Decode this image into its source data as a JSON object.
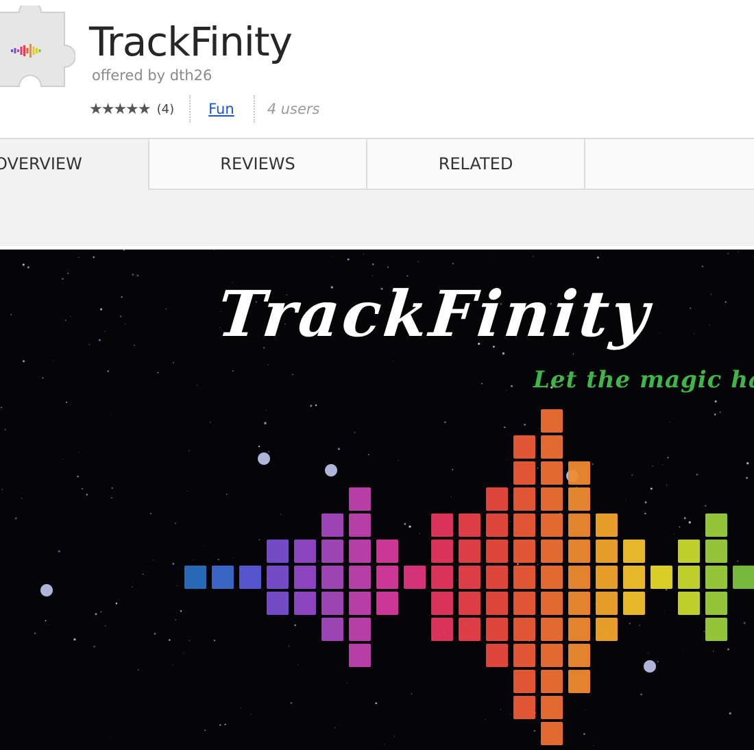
{
  "extension": {
    "title": "TrackFinity",
    "offered_by": "offered by dth26",
    "stars": "★★★★★",
    "rating_count": "(4)",
    "category": "Fun",
    "users": "4 users"
  },
  "tabs": [
    {
      "label": "OVERVIEW",
      "active": true
    },
    {
      "label": "REVIEWS",
      "active": false
    },
    {
      "label": "RELATED",
      "active": false
    }
  ],
  "screenshot": {
    "title": "TrackFinity",
    "tagline": "Let the magic happ",
    "colors": {
      "background": "#050507",
      "tagline": "#3fb54a",
      "title": "#ffffff"
    }
  },
  "icons": [
    "puzzle-extension-icon",
    "star-icon"
  ]
}
